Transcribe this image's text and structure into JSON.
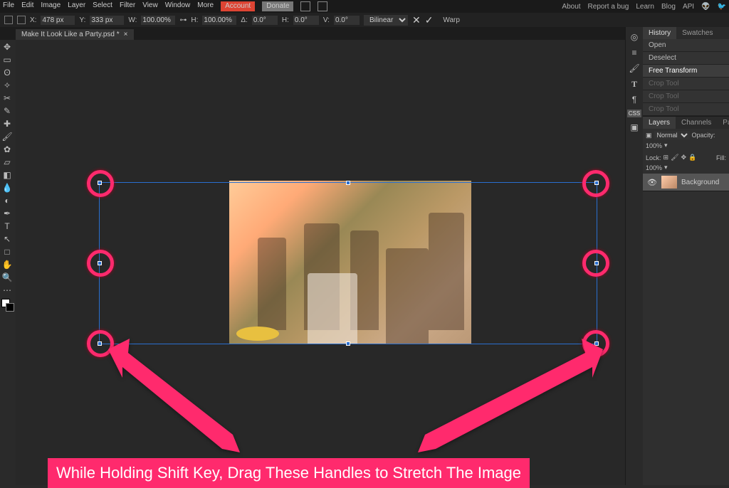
{
  "menu": {
    "items": [
      "File",
      "Edit",
      "Image",
      "Layer",
      "Select",
      "Filter",
      "View",
      "Window",
      "More"
    ],
    "account": "Account",
    "donate": "Donate",
    "right": [
      "About",
      "Report a bug",
      "Learn",
      "Blog",
      "API"
    ]
  },
  "options": {
    "x_label": "X:",
    "x": "478 px",
    "y_label": "Y:",
    "y": "333 px",
    "w_label": "W:",
    "w": "100.00%",
    "h_label": "H:",
    "h": "100.00%",
    "a_label": "Δ:",
    "a": "0.0°",
    "sh_label": "H:",
    "sh": "0.0°",
    "sv_label": "V:",
    "sv": "0.0°",
    "interp": "Bilinear",
    "warp": "Warp"
  },
  "tab": {
    "title": "Make It Look Like a Party.psd *"
  },
  "history": {
    "tabs": [
      "History",
      "Swatches"
    ],
    "items": [
      "Open",
      "Deselect",
      "Free Transform",
      "Crop Tool",
      "Crop Tool",
      "Crop Tool"
    ]
  },
  "layers": {
    "tabs": [
      "Layers",
      "Channels",
      "Paths"
    ],
    "mode": "Normal",
    "opacity_label": "Opacity:",
    "opacity": "100%",
    "lock_label": "Lock:",
    "fill_label": "Fill:",
    "fill": "100%",
    "row": {
      "name": "Background"
    }
  },
  "annotation": {
    "text": "While Holding Shift Key, Drag These Handles to Stretch The Image"
  },
  "tools": [
    "move",
    "rect-select",
    "lasso",
    "wand",
    "crop",
    "eyedrop",
    "heal",
    "brush",
    "stamp",
    "eraser",
    "grad",
    "blur",
    "dodge",
    "pen",
    "type",
    "path",
    "rect",
    "hand",
    "zoom"
  ],
  "rstrip": [
    "target",
    "menu",
    "brush",
    "T",
    "para",
    "css",
    "img"
  ]
}
